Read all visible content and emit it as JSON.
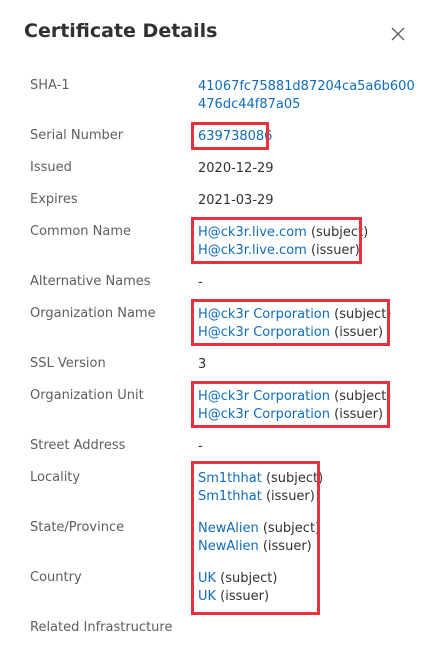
{
  "header": {
    "title": "Certificate Details",
    "close_icon": "close-icon"
  },
  "fields": {
    "sha1": {
      "label": "SHA-1",
      "line1": "41067fc75881d87204ca5a6b600",
      "line2": "476dc44f87a05"
    },
    "serial_number": {
      "label": "Serial Number",
      "value": "639738086"
    },
    "issued": {
      "label": "Issued",
      "value": "2020-12-29"
    },
    "expires": {
      "label": "Expires",
      "value": "2021-03-29"
    },
    "common_name": {
      "label": "Common Name",
      "subject_link": "H@ck3r.live.com",
      "subject_suffix": " (subject)",
      "issuer_link": "H@ck3r.live.com",
      "issuer_suffix": " (issuer)"
    },
    "alternative_names": {
      "label": "Alternative Names",
      "value": "-"
    },
    "organization_name": {
      "label": "Organization Name",
      "subject_link": "H@ck3r Corporation",
      "subject_suffix": " (subject)",
      "issuer_link": "H@ck3r Corporation",
      "issuer_suffix": " (issuer)"
    },
    "ssl_version": {
      "label": "SSL Version",
      "value": "3"
    },
    "organization_unit": {
      "label": "Organization Unit",
      "subject_link": "H@ck3r Corporation",
      "subject_suffix": " (subject)",
      "issuer_link": "H@ck3r Corporation",
      "issuer_suffix": " (issuer)"
    },
    "street_address": {
      "label": "Street Address",
      "value": "-"
    },
    "locality": {
      "label": "Locality",
      "subject_link": "Sm1thhat",
      "subject_suffix": " (subject)",
      "issuer_link": "Sm1thhat",
      "issuer_suffix": " (issuer)"
    },
    "state_province": {
      "label": "State/Province",
      "subject_link": "NewAlien",
      "subject_suffix": " (subject)",
      "issuer_link": "NewAlien",
      "issuer_suffix": " (issuer)"
    },
    "country": {
      "label": "Country",
      "subject_link": "UK",
      "subject_suffix": " (subject)",
      "issuer_link": "UK",
      "issuer_suffix": " (issuer)"
    },
    "related_infrastructure": {
      "label": "Related Infrastructure"
    }
  },
  "colors": {
    "link": "#0f6cbd",
    "highlight": "#e8303f",
    "label": "#605e5c",
    "text": "#323130"
  }
}
